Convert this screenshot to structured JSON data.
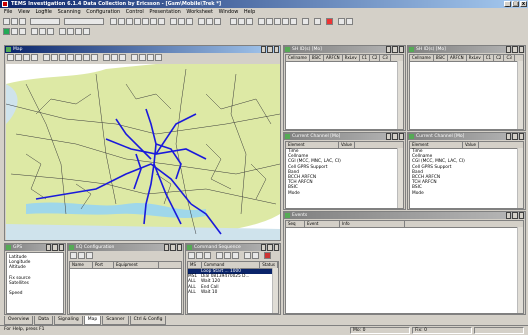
{
  "app": {
    "title": "TEMS Investigation 6.1.4 Data Collection by Ericsson - [Gsm\\Mobile\\Trek *]"
  },
  "menu": [
    "File",
    "View",
    "Logfile",
    "Scanning",
    "Configuration",
    "Control",
    "Presentation",
    "Worksheet",
    "Window",
    "Help"
  ],
  "map_window": {
    "title": "Map"
  },
  "sh_id_left": {
    "title": "SH ID(s) [Mo]",
    "columns": [
      "Cellname",
      "BSIC",
      "ARFCN",
      "RxLev",
      "C1",
      "C2",
      "C3"
    ]
  },
  "sh_id_right": {
    "title": "SH ID(s) [Mo]",
    "columns": [
      "Cellname",
      "BSIC",
      "ARFCN",
      "RxLev",
      "C1",
      "C2",
      "C3"
    ]
  },
  "current_channel_left": {
    "title": "Current Channel [Mo]",
    "columns": [
      "Element",
      "Value"
    ],
    "rows": [
      "Time",
      "Cellname",
      "CGI (MCC, MNC, LAC, CI)",
      "Cell GPRS Support",
      "Band",
      "BCCH ARFCN",
      "TCH ARFCN",
      "BSIC",
      "Mode"
    ]
  },
  "current_channel_right": {
    "title": "Current Channel [Mo]",
    "columns": [
      "Element",
      "Value"
    ],
    "rows": [
      "Time",
      "Cellname",
      "CGI (MCC, MNC, LAC, CI)",
      "Cell GPRS Support",
      "Band",
      "BCCH ARFCN",
      "TCH ARFCN",
      "BSIC",
      "Mode"
    ]
  },
  "events": {
    "title": "Events",
    "columns": [
      "Seq",
      "Event",
      "Info"
    ]
  },
  "gps": {
    "title": "GPS",
    "rows": [
      "Latitude",
      "Longitude",
      "Altitude",
      "",
      "Fix source",
      "Satellites",
      "",
      "Speed"
    ]
  },
  "equipment": {
    "title": "EQ Configuration",
    "columns": [
      "Name",
      "Port",
      "Equipment"
    ]
  },
  "command_sequence": {
    "title": "Command Sequence",
    "columns": [
      "MS",
      "Command",
      "Status"
    ],
    "rows": [
      {
        "ms": "",
        "cmd": "Loop Start ... 1000",
        "highlight": true
      },
      {
        "ms": "MS1",
        "cmd": "Dial 08139470025 D...",
        "highlight": false
      },
      {
        "ms": "ALL",
        "cmd": "Wait 120",
        "highlight": false
      },
      {
        "ms": "ALL",
        "cmd": "End Call",
        "highlight": false
      },
      {
        "ms": "ALL",
        "cmd": "Wait 10",
        "highlight": false
      }
    ]
  },
  "worksheet_tabs": [
    "Overview",
    "Data",
    "Signaling",
    "Map",
    "Scanner",
    "Ctrl & Config"
  ],
  "selected_tab": "Map",
  "status": {
    "help": "For Help, press F1",
    "mo": "Mo: 0",
    "fix": "Fix: 0"
  }
}
